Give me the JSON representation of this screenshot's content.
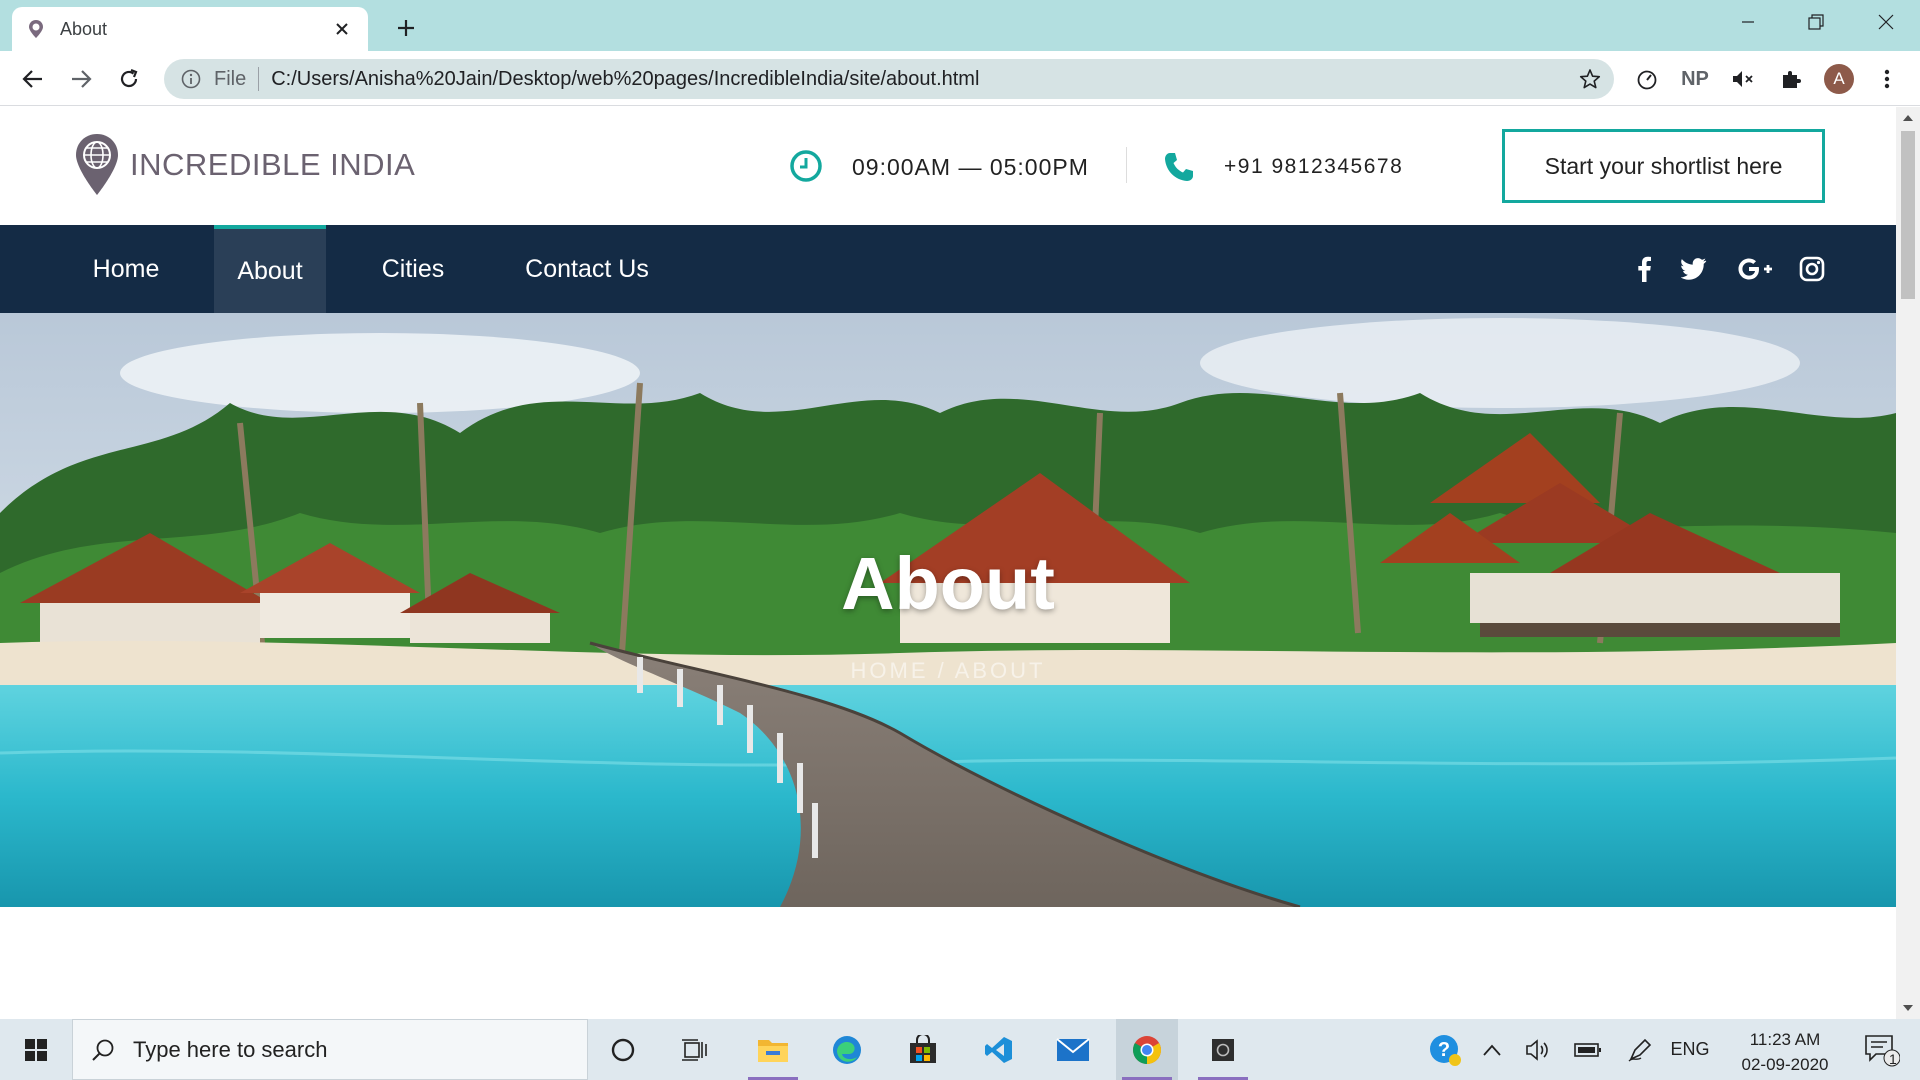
{
  "browser": {
    "tab_title": "About",
    "omnibox_scheme": "File",
    "omnibox_url": "C:/Users/Anisha%20Jain/Desktop/web%20pages/IncredibleIndia/site/about.html",
    "extension_np": "NP",
    "profile_initial": "A"
  },
  "site": {
    "logo_text": "INCREDIBLE INDIA",
    "hours": "09:00AM — 05:00PM",
    "phone": "+91 9812345678",
    "shortlist_button": "Start your shortlist here",
    "nav": [
      {
        "label": "Home",
        "active": false
      },
      {
        "label": "About",
        "active": true
      },
      {
        "label": "Cities",
        "active": false
      },
      {
        "label": "Contact Us",
        "active": false
      }
    ],
    "social_icons": [
      "facebook-icon",
      "twitter-icon",
      "google-plus-icon",
      "instagram-icon"
    ],
    "accent_color": "#13a89e",
    "nav_color": "#142b45",
    "hero": {
      "title": "About",
      "breadcrumb": "HOME   /   ABOUT"
    }
  },
  "taskbar": {
    "search_placeholder": "Type here to search",
    "language": "ENG",
    "time": "11:23 AM",
    "date": "02-09-2020",
    "notification_count": "1"
  }
}
